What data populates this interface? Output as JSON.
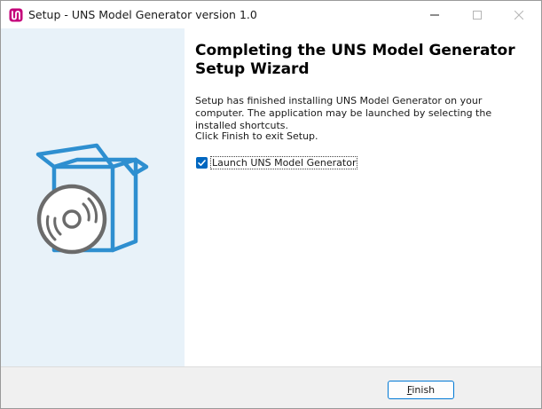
{
  "window": {
    "title": "Setup - UNS Model Generator version 1.0",
    "app_icon": "uns-app-icon",
    "controls": {
      "minimize_icon": "minimize-icon",
      "maximize_icon": "maximize-icon",
      "close_icon": "close-icon"
    }
  },
  "wizard": {
    "heading": "Completing the UNS Model Generator Setup Wizard",
    "message": "Setup has finished installing UNS Model Generator on your computer. The application may be launched by selecting the installed shortcuts.",
    "exit_instruction": "Click Finish to exit Setup.",
    "launch_checkbox": {
      "label": "Launch UNS Model Generator",
      "checked": true
    },
    "side_graphic": "software-box-cd-icon"
  },
  "footer": {
    "finish_label_mnemonic": "F",
    "finish_label_rest": "inish"
  },
  "colors": {
    "accent": "#0067c0",
    "side_panel": "#e8f2f9",
    "graphic_blue": "#2e8fd0",
    "graphic_gray": "#6b6b6b",
    "app_icon": "#c4007a"
  }
}
